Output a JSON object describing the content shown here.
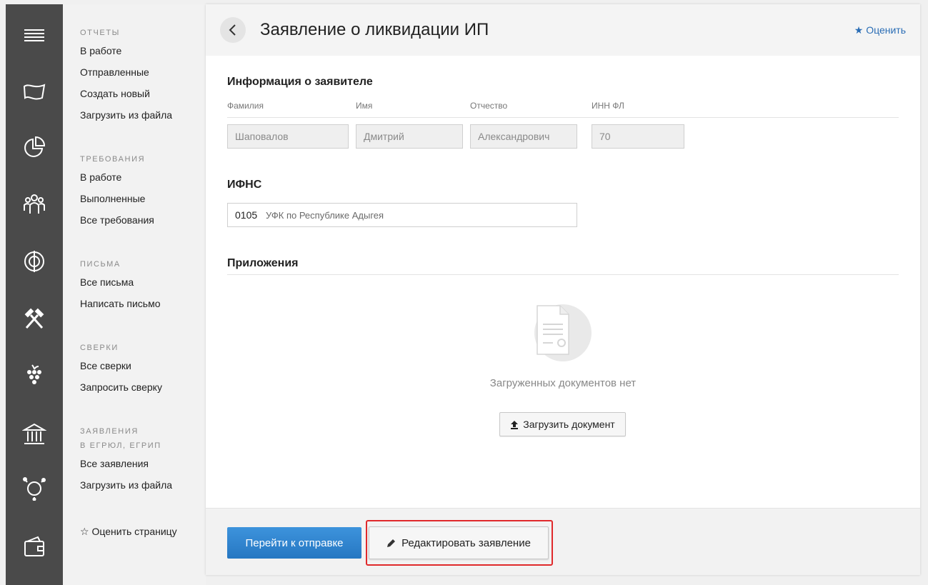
{
  "sidebar_rail": {
    "icons": [
      "menu-icon",
      "flag-icon",
      "pie-chart-icon",
      "people-icon",
      "target-icon",
      "hammers-icon",
      "grapes-icon",
      "bank-icon",
      "recycle-icon",
      "wallet-icon"
    ]
  },
  "subnav": {
    "groups": [
      {
        "heading": "ОТЧЕТЫ",
        "items": [
          "В работе",
          "Отправленные",
          "Создать новый",
          "Загрузить из файла"
        ]
      },
      {
        "heading": "ТРЕБОВАНИЯ",
        "items": [
          "В работе",
          "Выполненные",
          "Все требования"
        ]
      },
      {
        "heading": "ПИСЬМА",
        "items": [
          "Все письма",
          "Написать письмо"
        ]
      },
      {
        "heading": "СВЕРКИ",
        "items": [
          "Все сверки",
          "Запросить сверку"
        ]
      },
      {
        "heading": "ЗАЯВЛЕНИЯ",
        "heading2": "В ЕГРЮЛ, ЕГРИП",
        "items": [
          "Все заявления",
          "Загрузить из файла"
        ]
      }
    ],
    "rate_page": "☆ Оценить страницу"
  },
  "header": {
    "title": "Заявление о ликвидации ИП",
    "rate_label": "★ Оценить"
  },
  "applicant": {
    "section_title": "Информация о заявителе",
    "labels": {
      "surname": "Фамилия",
      "name": "Имя",
      "patronymic": "Отчество",
      "inn": "ИНН ФЛ"
    },
    "values": {
      "surname": "Шаповалов",
      "name": "Дмитрий",
      "patronymic": "Александрович",
      "inn": "70"
    }
  },
  "ifns": {
    "section_title": "ИФНС",
    "code": "0105",
    "name": "УФК по Республике Адыгея"
  },
  "attachments": {
    "section_title": "Приложения",
    "empty_text": "Загруженных документов нет",
    "upload_label": "Загрузить документ"
  },
  "footer": {
    "submit_label": "Перейти к отправке",
    "edit_label": "Редактировать заявление"
  },
  "colors": {
    "rail": "#4a4a4a",
    "primary": "#2f86d0",
    "highlight": "#e0292b",
    "link": "#2a6db5"
  }
}
